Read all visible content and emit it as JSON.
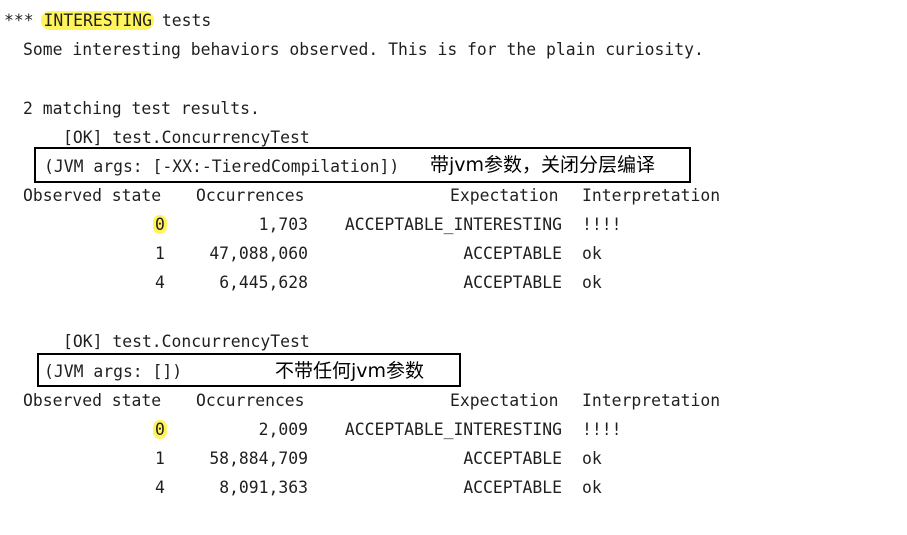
{
  "header": {
    "prefix": "***",
    "keyword": "INTERESTING",
    "suffix": "tests",
    "description": "Some interesting behaviors observed. This is for the plain curiosity."
  },
  "summary": "2 matching test results.",
  "columns": {
    "state": "Observed state",
    "occurrences": "Occurrences",
    "expectation": "Expectation",
    "interpretation": "Interpretation"
  },
  "results": [
    {
      "status": "[OK] test.ConcurrencyTest",
      "jvm_args": "(JVM args: [-XX:-TieredCompilation])",
      "annotation": "带jvm参数，关闭分层编译",
      "rows": [
        {
          "state": "0",
          "occurrences": "1,703",
          "expectation": "ACCEPTABLE_INTERESTING",
          "interpretation": "!!!!"
        },
        {
          "state": "1",
          "occurrences": "47,088,060",
          "expectation": "ACCEPTABLE",
          "interpretation": "ok"
        },
        {
          "state": "4",
          "occurrences": "6,445,628",
          "expectation": "ACCEPTABLE",
          "interpretation": "ok"
        }
      ]
    },
    {
      "status": "[OK] test.ConcurrencyTest",
      "jvm_args": "(JVM args: [])",
      "annotation": "不带任何jvm参数",
      "rows": [
        {
          "state": "0",
          "occurrences": "2,009",
          "expectation": "ACCEPTABLE_INTERESTING",
          "interpretation": "!!!!"
        },
        {
          "state": "1",
          "occurrences": "58,884,709",
          "expectation": "ACCEPTABLE",
          "interpretation": "ok"
        },
        {
          "state": "4",
          "occurrences": "8,091,363",
          "expectation": "ACCEPTABLE",
          "interpretation": "ok"
        }
      ]
    }
  ]
}
